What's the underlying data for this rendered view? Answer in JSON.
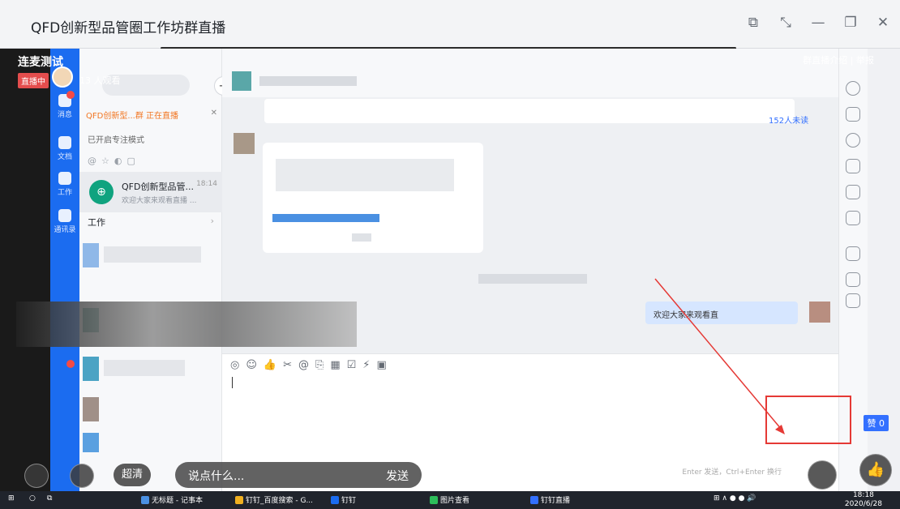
{
  "window": {
    "title": "QFD创新型品管圈工作坊群直播",
    "controls": [
      "⧉",
      "⤡",
      "—",
      "❐",
      "✕"
    ]
  },
  "live": {
    "room_title": "连麦测试",
    "status_badge": "直播中",
    "viewers": "13 人观看",
    "top_links": "群直播介绍 | 举报",
    "like_label": "赞 0",
    "bottom": {
      "quality": "超清",
      "comment_placeholder": "说点什么...",
      "send": "发送"
    }
  },
  "app": {
    "rail": [
      {
        "label": "消息"
      },
      {
        "label": "文档"
      },
      {
        "label": "工作"
      },
      {
        "label": "通讯录"
      }
    ],
    "live_notice": "QFD创新型...群 正在直播",
    "focus_mode": "已开启专注模式",
    "chat": {
      "name": "QFD创新型品管...",
      "time": "18:14",
      "preview": "欢迎大家来观看直播 ..."
    },
    "section_work": "工作",
    "unread": "152人未读",
    "welcome_message": "欢迎大家来观看直",
    "send_hint": "Enter 发送，Ctrl+Enter 换行"
  },
  "taskbar": {
    "items": [
      "无标题 - 记事本",
      "钉钉_百度搜索 - G...",
      "钉钉",
      "图片查看",
      "钉钉直播"
    ],
    "time": "18:18",
    "date": "2020/6/28"
  },
  "colors": {
    "accent": "#1b6cf0",
    "live_red": "#e34d4d",
    "annotation_red": "#e53935",
    "link_blue": "#3370ff"
  }
}
